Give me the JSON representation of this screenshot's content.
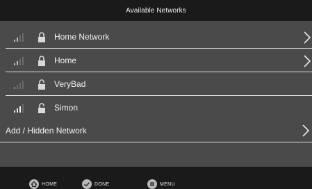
{
  "title": "Available Networks",
  "networks": [
    {
      "name": "Home Network",
      "signal_bars": 2,
      "locked": true,
      "chevron": true
    },
    {
      "name": "Home",
      "signal_bars": 2,
      "locked": true,
      "chevron": true
    },
    {
      "name": "VeryBad",
      "signal_bars": 1,
      "locked": false,
      "chevron": false
    },
    {
      "name": "Simon",
      "signal_bars": 3,
      "locked": false,
      "chevron": false
    }
  ],
  "add_hidden": {
    "label": "Add / Hidden Network"
  },
  "bottom_nav": {
    "home": "HOME",
    "done": "DONE",
    "menu": "MENU"
  },
  "colors": {
    "list_bg": "#4a4a4a",
    "bar_bg": "#1a1a1a",
    "divider": "#e0e0e0",
    "icon_dim": "#8a8a8a"
  }
}
